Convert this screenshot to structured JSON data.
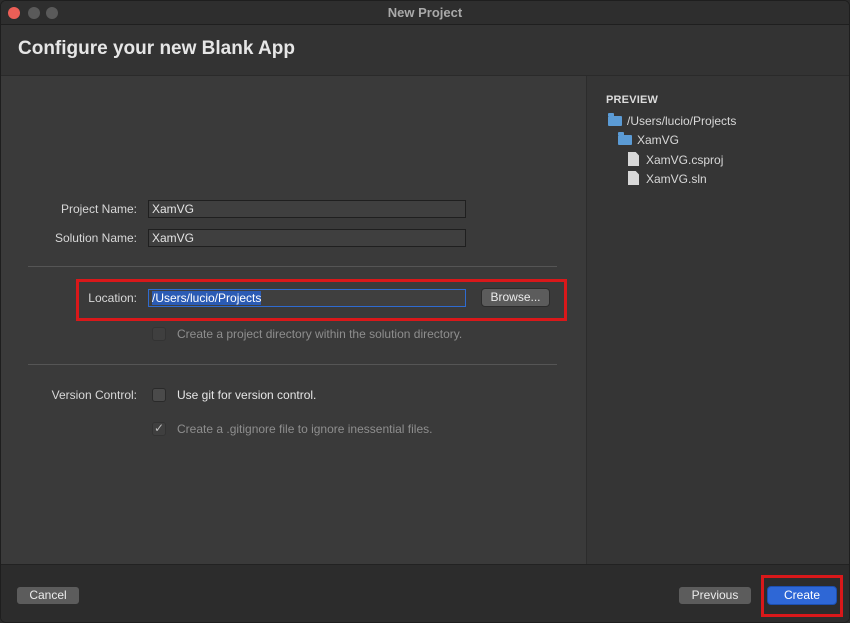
{
  "window": {
    "title": "New Project"
  },
  "header": {
    "title": "Configure your new Blank App"
  },
  "form": {
    "project_name_label": "Project Name:",
    "project_name_value": "XamVG",
    "solution_name_label": "Solution Name:",
    "solution_name_value": "XamVG",
    "location_label": "Location:",
    "location_value": "/Users/lucio/Projects",
    "browse_label": "Browse...",
    "project_dir_checkbox_label": "Create a project directory within the solution directory.",
    "project_dir_checked": false,
    "version_control_label": "Version Control:",
    "git_checkbox_label": "Use git for version control.",
    "git_checked": false,
    "gitignore_checkbox_label": "Create a .gitignore file to ignore inessential files.",
    "gitignore_checked": true
  },
  "preview": {
    "title": "PREVIEW",
    "tree": [
      {
        "type": "folder",
        "label": "/Users/lucio/Projects",
        "icon": "folder-icon"
      },
      {
        "type": "folder",
        "label": "XamVG",
        "icon": "folder-icon"
      },
      {
        "type": "file",
        "label": "XamVG.csproj",
        "icon": "file-icon"
      },
      {
        "type": "file",
        "label": "XamVG.sln",
        "icon": "file-icon"
      }
    ]
  },
  "footer": {
    "cancel_label": "Cancel",
    "previous_label": "Previous",
    "create_label": "Create"
  },
  "colors": {
    "accent": "#2e67d6",
    "highlight": "#d9181a",
    "folder": "#5b9bd5"
  }
}
